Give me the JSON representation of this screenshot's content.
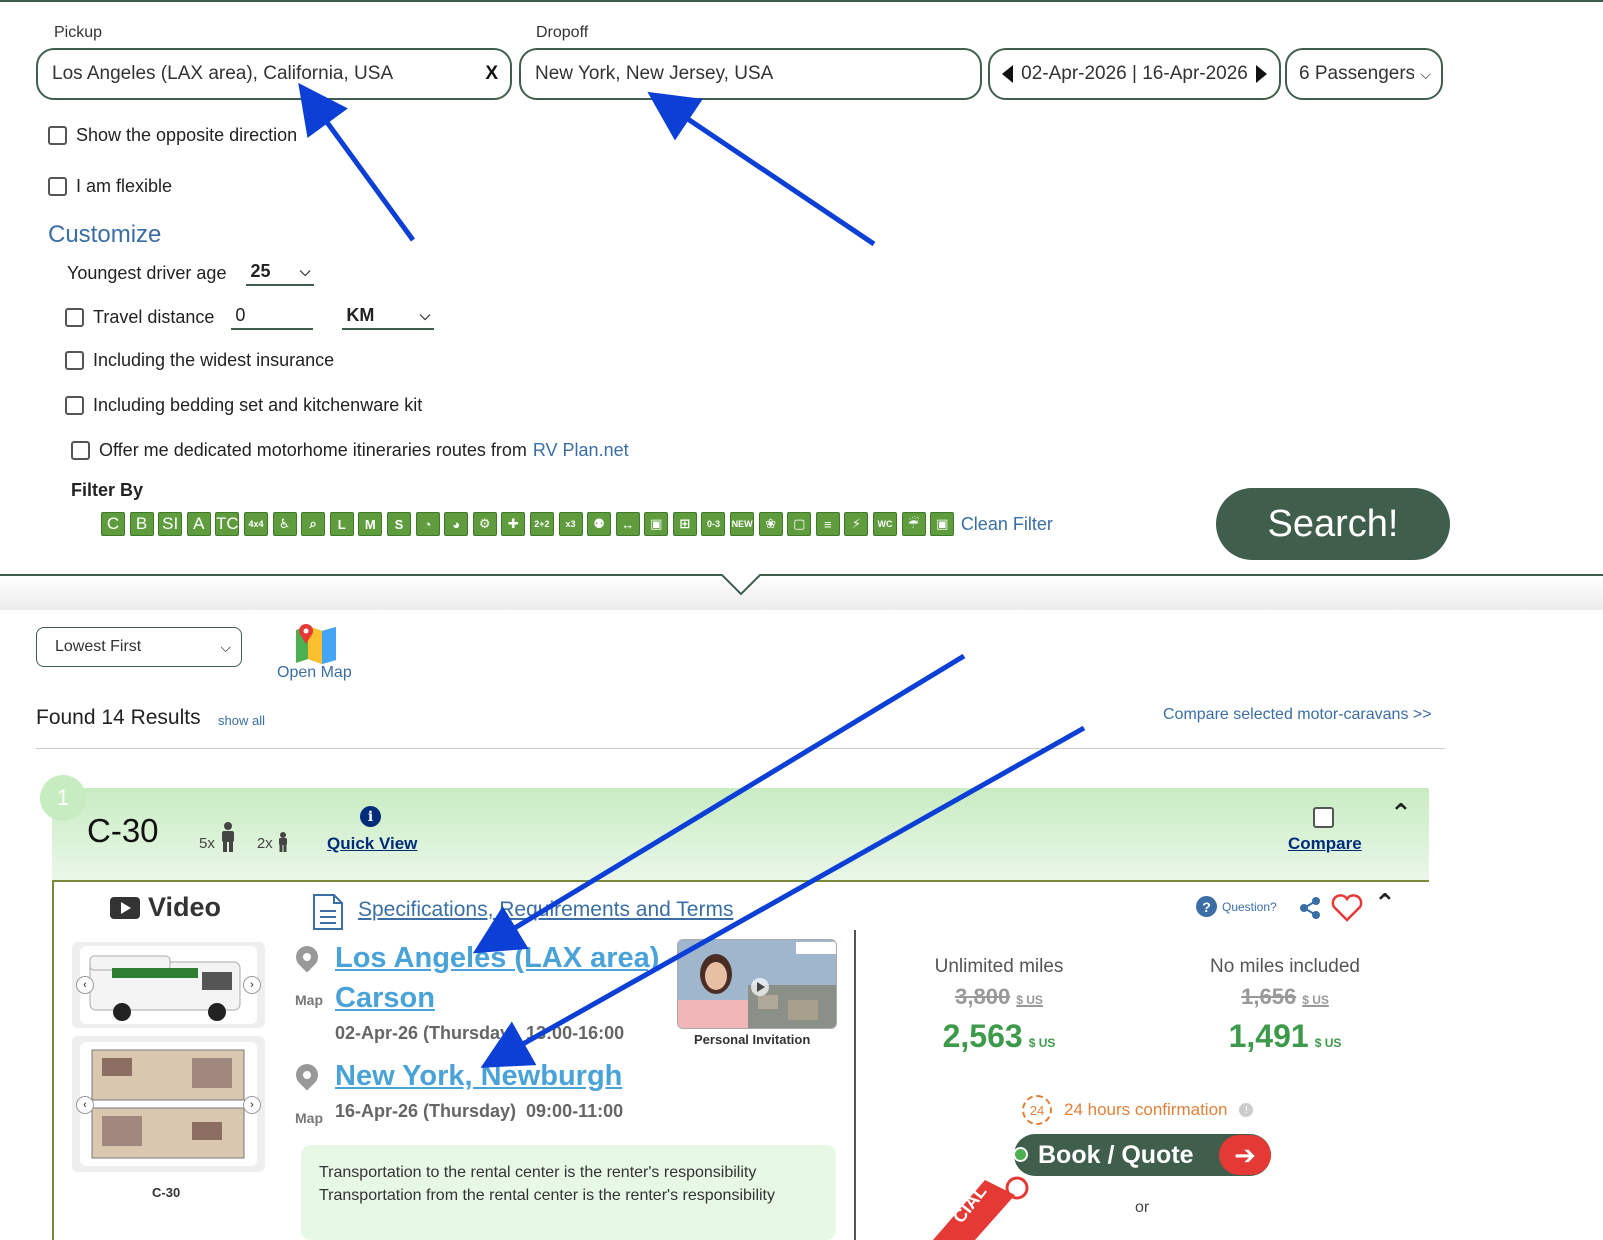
{
  "search": {
    "pickup_label": "Pickup",
    "pickup_value": "Los Angeles (LAX area), California, USA",
    "clear_symbol": "X",
    "dropoff_label": "Dropoff",
    "dropoff_value": "New York, New Jersey, USA",
    "dates_value": "02-Apr-2026 | 16-Apr-2026",
    "passengers_value": "6 Passengers",
    "opposite_direction_label": "Show the opposite direction",
    "flexible_label": "I am flexible"
  },
  "customize": {
    "title": "Customize",
    "driver_age_label": "Youngest driver age",
    "driver_age_value": "25",
    "travel_distance_label": "Travel distance",
    "travel_distance_value": "0",
    "distance_unit": "KM",
    "insurance_label": "Including the widest insurance",
    "bedding_label": "Including bedding set and kitchenware kit",
    "itineraries_label": "Offer me dedicated motorhome itineraries routes from",
    "itineraries_link": "RV Plan.net"
  },
  "filter": {
    "title": "Filter By",
    "text_chips": [
      "C",
      "B",
      "SI",
      "A",
      "TC"
    ],
    "icon_chips": [
      "4x4",
      "wheelchair",
      "search-zoom",
      "L",
      "M",
      "S",
      "gauge-1",
      "gauge-2",
      "gear",
      "plus",
      "2+2",
      "x3",
      "family",
      "width",
      "bus-1",
      "bus-plus",
      "0-3",
      "NEW",
      "paw",
      "tv",
      "bed",
      "lightning",
      "WC",
      "shower",
      "bus-2"
    ],
    "clean_label": "Clean Filter",
    "search_button": "Search!"
  },
  "results": {
    "sort_value": "Lowest First",
    "open_map_label": "Open Map",
    "found_text": "Found 14 Results",
    "show_all_label": "show all",
    "compare_selected_label": "Compare selected motor-caravans >>"
  },
  "card": {
    "number": "1",
    "model": "C-30",
    "adults": "5x",
    "children": "2x",
    "quick_view": "Quick View",
    "compare_label": "Compare",
    "video_label": "Video",
    "thumb_caption": "C-30",
    "specs_link": "Specifications, Requirements and Terms",
    "question_label": "Question?",
    "pickup_location_line1": "Los Angeles (LAX area)",
    "pickup_location_line2": "Carson",
    "pickup_datetime": "02-Apr-26 (Thursday)  13:00-16:00",
    "dropoff_location": "New York, Newburgh",
    "dropoff_datetime": "16-Apr-26 (Thursday)  09:00-11:00",
    "map_label": "Map",
    "invitation_label": "Personal Invitation",
    "notice_line1": "Transportation to the rental center is the renter's responsibility",
    "notice_line2": "Transportation from the rental center is the renter's responsibility",
    "unlimited_title": "Unlimited miles",
    "unlimited_old": "3,800",
    "unlimited_new": "2,563",
    "nomiles_title": "No miles included",
    "nomiles_old": "1,656",
    "nomiles_new": "1,491",
    "currency": "$ US",
    "confirm_badge": "24",
    "confirm_text": "24 hours confirmation",
    "book_label": "Book / Quote",
    "or_label": "or",
    "ribbon_text": "CIAL"
  },
  "colors": {
    "brand_green": "#3f5f4c",
    "link_blue": "#3a6ea5",
    "price_green": "#3d9a4a",
    "location_blue": "#4aa3d8",
    "annotation_arrow": "#0b3fd6",
    "accent_red": "#e53935",
    "confirm_orange": "#e0813a"
  }
}
